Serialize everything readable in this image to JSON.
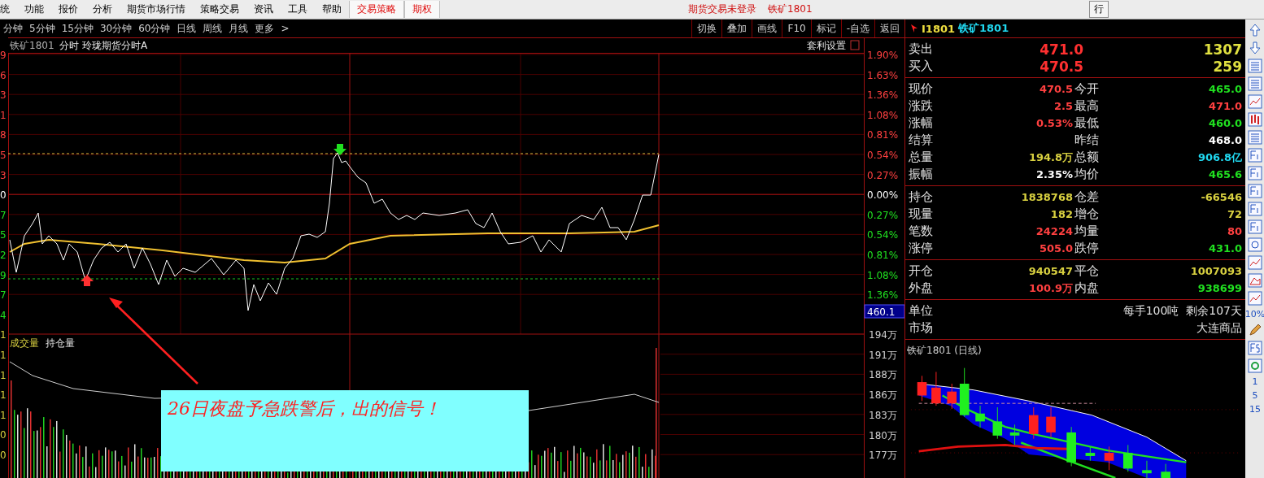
{
  "menu_bar": {
    "items": [
      {
        "label": "统",
        "kind": "normal"
      },
      {
        "label": "功能",
        "kind": "normal"
      },
      {
        "label": "报价",
        "kind": "normal"
      },
      {
        "label": "分析",
        "kind": "normal"
      },
      {
        "label": "期货市场行情",
        "kind": "normal"
      },
      {
        "label": "策略交易",
        "kind": "normal"
      },
      {
        "label": "资讯",
        "kind": "normal"
      },
      {
        "label": "工具",
        "kind": "normal"
      },
      {
        "label": "帮助",
        "kind": "normal"
      },
      {
        "label": "交易策略",
        "kind": "featured"
      },
      {
        "label": "期权",
        "kind": "featured"
      }
    ],
    "status": [
      "期货交易未登录",
      "铁矿1801"
    ],
    "right_button": "行"
  },
  "period_bar": {
    "periods": [
      {
        "label": "分钟",
        "selected": false
      },
      {
        "label": "5分钟",
        "selected": false
      },
      {
        "label": "15分钟",
        "selected": false
      },
      {
        "label": "30分钟",
        "selected": false
      },
      {
        "label": "60分钟",
        "selected": false
      },
      {
        "label": "日线",
        "selected": false
      },
      {
        "label": "周线",
        "selected": false
      },
      {
        "label": "月线",
        "selected": false
      },
      {
        "label": "更多",
        "selected": false
      }
    ],
    "more_arrow": ">",
    "tools": [
      "切换",
      "叠加",
      "画线",
      "F10",
      "标记",
      "-自选",
      "返回"
    ]
  },
  "chart": {
    "symbol": "铁矿1801",
    "mode": "分时",
    "indicator": "玲珑期货分时A",
    "arbitrage": "套利设置",
    "left_axis": [
      {
        "label": "9",
        "color": "#ff4040"
      },
      {
        "label": "6",
        "color": "#ff4040"
      },
      {
        "label": "3",
        "color": "#ff4040"
      },
      {
        "label": "1",
        "color": "#ff4040"
      },
      {
        "label": "8",
        "color": "#ff4040"
      },
      {
        "label": "5",
        "color": "#ff4040"
      },
      {
        "label": "3",
        "color": "#ff4040"
      },
      {
        "label": "0",
        "color": "#ffffff"
      },
      {
        "label": "7",
        "color": "#20e020"
      },
      {
        "label": "5",
        "color": "#20e020"
      },
      {
        "label": "2",
        "color": "#20e020"
      },
      {
        "label": "9",
        "color": "#20e020"
      },
      {
        "label": "7",
        "color": "#20e020"
      },
      {
        "label": "4",
        "color": "#20e020"
      },
      {
        "label": "1",
        "color": "#d8d040"
      },
      {
        "label": "1",
        "color": "#d8d040"
      },
      {
        "label": "1",
        "color": "#d8d040"
      },
      {
        "label": "1",
        "color": "#d8d040"
      },
      {
        "label": "1",
        "color": "#d8d040"
      },
      {
        "label": "0",
        "color": "#d8d040"
      },
      {
        "label": "0",
        "color": "#d8d040"
      }
    ],
    "right_axis": [
      {
        "label": "1.90%",
        "color": "#ff4040"
      },
      {
        "label": "1.63%",
        "color": "#ff4040"
      },
      {
        "label": "1.36%",
        "color": "#ff4040"
      },
      {
        "label": "1.08%",
        "color": "#ff4040"
      },
      {
        "label": "0.81%",
        "color": "#ff4040"
      },
      {
        "label": "0.54%",
        "color": "#ff4040"
      },
      {
        "label": "0.27%",
        "color": "#ff4040"
      },
      {
        "label": "0.00%",
        "color": "#ffffff"
      },
      {
        "label": "0.27%",
        "color": "#20e020"
      },
      {
        "label": "0.54%",
        "color": "#20e020"
      },
      {
        "label": "0.81%",
        "color": "#20e020"
      },
      {
        "label": "1.08%",
        "color": "#20e020"
      },
      {
        "label": "1.36%",
        "color": "#20e020"
      }
    ],
    "price_tag": "460.1",
    "volume_legend": [
      "成交量",
      "持仓量"
    ],
    "volume_axis": [
      "194万",
      "191万",
      "188万",
      "186万",
      "183万",
      "180万",
      "177万"
    ]
  },
  "callout": {
    "text": "26日夜盘予急跌警后，出的信号！"
  },
  "quote_panel": {
    "code": "I1801",
    "name": "铁矿1801",
    "book": [
      {
        "label": "卖出",
        "price": "471.0",
        "volume": "1307"
      },
      {
        "label": "买入",
        "price": "470.5",
        "volume": "259"
      }
    ],
    "sections": [
      [
        {
          "left": {
            "label": "现价",
            "value": "470.5",
            "color": "#ff4040"
          },
          "right": {
            "label": "今开",
            "value": "465.0",
            "color": "#20e020"
          }
        },
        {
          "left": {
            "label": "涨跌",
            "value": "2.5",
            "color": "#ff4040"
          },
          "right": {
            "label": "最高",
            "value": "471.0",
            "color": "#ff4040"
          }
        },
        {
          "left": {
            "label": "涨幅",
            "value": "0.53%",
            "color": "#ff4040"
          },
          "right": {
            "label": "最低",
            "value": "460.0",
            "color": "#20e020"
          }
        },
        {
          "left": {
            "label": "结算"
          },
          "right": {
            "label": "昨结",
            "value": "468.0",
            "color": "#ffffff"
          }
        },
        {
          "left": {
            "label": "总量",
            "value": "194.8万",
            "color": "#d8d040"
          },
          "right": {
            "label": "总额",
            "value": "906.8亿",
            "color": "#20d8f0"
          }
        },
        {
          "left": {
            "label": "振幅",
            "value": "2.35%",
            "color": "#ffffff"
          },
          "right": {
            "label": "均价",
            "value": "465.6",
            "color": "#20e020"
          }
        }
      ],
      [
        {
          "left": {
            "label": "持仓",
            "value": "1838768",
            "color": "#d8d040"
          },
          "right": {
            "label": "仓差",
            "value": "-66546",
            "color": "#d8d040"
          }
        },
        {
          "left": {
            "label": "现量",
            "value": "182",
            "color": "#d8d040"
          },
          "right": {
            "label": "增仓",
            "value": "72",
            "color": "#d8d040"
          }
        },
        {
          "left": {
            "label": "笔数",
            "value": "24224",
            "color": "#ff4040"
          },
          "right": {
            "label": "均量",
            "value": "80",
            "color": "#ff4040"
          }
        },
        {
          "left": {
            "label": "涨停",
            "value": "505.0",
            "color": "#ff4040"
          },
          "right": {
            "label": "跌停",
            "value": "431.0",
            "color": "#20e020"
          }
        }
      ],
      [
        {
          "left": {
            "label": "开仓",
            "value": "940547",
            "color": "#d8d040"
          },
          "right": {
            "label": "平仓",
            "value": "1007093",
            "color": "#d8d040"
          }
        },
        {
          "left": {
            "label": "外盘",
            "value": "100.9万",
            "color": "#ff4040"
          },
          "right": {
            "label": "内盘",
            "value": "938699",
            "color": "#20e020"
          }
        }
      ]
    ],
    "info": [
      {
        "label": "单位",
        "value": "每手100吨  剩余107天"
      },
      {
        "label": "市场",
        "value": "大连商品"
      }
    ],
    "daily_chart_title": "铁矿1801 (日线)"
  },
  "side_toolbar": {
    "labels": [
      "10%",
      "1",
      "5",
      "15"
    ]
  }
}
